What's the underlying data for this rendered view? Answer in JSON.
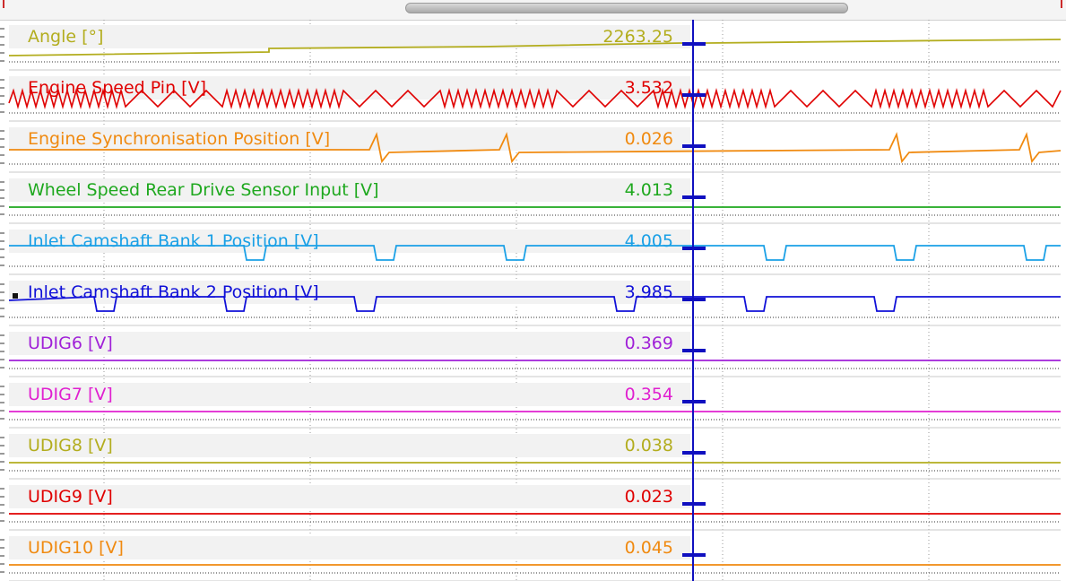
{
  "channels": [
    {
      "label": "Angle [°]",
      "value": "2263.25",
      "color": "#b3ad1e",
      "kind": "ramp"
    },
    {
      "label": "Engine Speed Pin [V]",
      "value": "3.532",
      "color": "#e00000",
      "kind": "zigzag"
    },
    {
      "label": "Engine Synchronisation Position [V]",
      "value": "0.026",
      "color": "#f08a10",
      "kind": "sync"
    },
    {
      "label": "Wheel Speed Rear Drive Sensor Input [V]",
      "value": "4.013",
      "color": "#1ea81e",
      "kind": "flat"
    },
    {
      "label": "Inlet Camshaft Bank 1 Position [V]",
      "value": "4.005",
      "color": "#1aa0e6",
      "kind": "cam",
      "selected": false
    },
    {
      "label": "Inlet Camshaft Bank 2 Position [V]",
      "value": "3.985",
      "color": "#1010d8",
      "kind": "cam",
      "selected": true
    },
    {
      "label": "UDIG6 [V]",
      "value": "0.369",
      "color": "#a020d8",
      "kind": "flat"
    },
    {
      "label": "UDIG7 [V]",
      "value": "0.354",
      "color": "#e020d0",
      "kind": "flat"
    },
    {
      "label": "UDIG8 [V]",
      "value": "0.038",
      "color": "#b3ad1e",
      "kind": "flat"
    },
    {
      "label": "UDIG9 [V]",
      "value": "0.023",
      "color": "#e00000",
      "kind": "flat"
    },
    {
      "label": "UDIG10 [V]",
      "value": "0.045",
      "color": "#f08a10",
      "kind": "flat"
    }
  ],
  "cursor_color": "#1010c0",
  "grid_color": "#9a9a9a"
}
